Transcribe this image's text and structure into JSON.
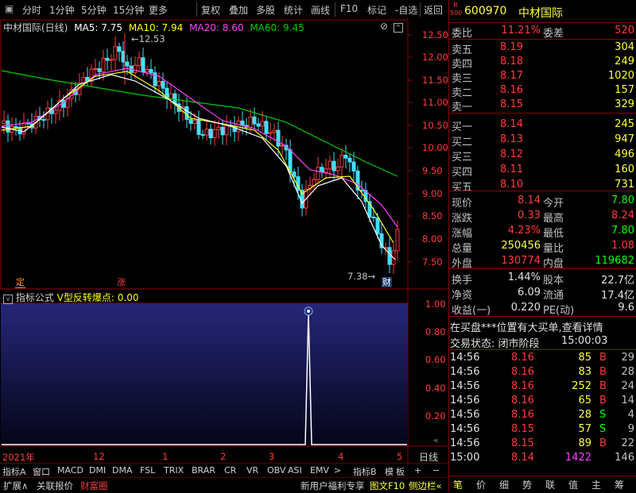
{
  "toolbar": {
    "tabs": [
      "分时",
      "1分钟",
      "5分钟",
      "15分钟",
      "更多",
      "复权",
      "叠加",
      "多股",
      "统计",
      "画线",
      "F10",
      "标记",
      "-自选",
      "返回"
    ]
  },
  "chart": {
    "title": "中材国际(日线)",
    "ma5_label": "MA5: 7.75",
    "ma10_label": "MA10: 7.94",
    "ma20_label": "MA20: 8.60",
    "ma60_label": "MA60: 9.45",
    "high_mark": "12.53",
    "low_mark": "7.38",
    "price_ticks": [
      "12.50",
      "12.00",
      "11.50",
      "11.00",
      "10.50",
      "10.00",
      "9.50",
      "9.00",
      "8.50",
      "8.00",
      "7.50"
    ],
    "markers": {
      "ding": "定",
      "zhang": "涨",
      "cai": "财"
    },
    "colors": {
      "ma5": "#ffffff",
      "ma10": "#ffff00",
      "ma20": "#ff40ff",
      "ma60": "#00cc00",
      "up": "#ff3c3c",
      "down": "#40e0ff"
    }
  },
  "indicator": {
    "label_name": "指标公式",
    "label_formula": "V型反转爆点: 0.00",
    "ticks": [
      "1.00",
      "0.80",
      "0.60",
      "0.40",
      "0.20"
    ],
    "corner_label": "«"
  },
  "xaxis": {
    "labels": [
      "2021年",
      "12",
      "1",
      "2",
      "3",
      "4",
      "5"
    ],
    "period_label": "日线"
  },
  "indicator_tabs": [
    "指标A",
    "窗口",
    "MACD",
    "DMI",
    "DMA",
    "FSL",
    "TRIX",
    "BRAR",
    "CR",
    "VR",
    "OBV",
    "ASI",
    "EMV",
    ">",
    "指标B",
    "模",
    "板",
    "+",
    "−"
  ],
  "bottom_bar": {
    "left": [
      "扩展∧",
      "关联报价",
      "财富圈"
    ],
    "ad": "新用户福利专享",
    "tool1": "图文F10",
    "tool2": "侧边栏«",
    "right": [
      "笔",
      "价",
      "细",
      "势",
      "联",
      "值",
      "主",
      "筹"
    ]
  },
  "quote": {
    "badge_top": "R",
    "badge_bottom": "500",
    "code": "600970",
    "name": "中材国际",
    "weibi_label": "委比",
    "weibi_value": "11.21%",
    "weicha_label": "委差",
    "weicha_value": "520",
    "sells": [
      {
        "label": "卖五",
        "price": "8.19",
        "vol": "304"
      },
      {
        "label": "卖四",
        "price": "8.18",
        "vol": "249"
      },
      {
        "label": "卖三",
        "price": "8.17",
        "vol": "1020"
      },
      {
        "label": "卖二",
        "price": "8.16",
        "vol": "157"
      },
      {
        "label": "卖一",
        "price": "8.15",
        "vol": "329"
      }
    ],
    "buys": [
      {
        "label": "买一",
        "price": "8.14",
        "vol": "245"
      },
      {
        "label": "买二",
        "price": "8.13",
        "vol": "947"
      },
      {
        "label": "买三",
        "price": "8.12",
        "vol": "496"
      },
      {
        "label": "买四",
        "price": "8.11",
        "vol": "160"
      },
      {
        "label": "买五",
        "price": "8.10",
        "vol": "731"
      }
    ],
    "stats": [
      {
        "l1": "现价",
        "v1": "8.14",
        "l2": "今开",
        "v2": "7.80"
      },
      {
        "l1": "涨跌",
        "v1": "0.33",
        "l2": "最高",
        "v2": "8.24"
      },
      {
        "l1": "涨幅",
        "v1": "4.23%",
        "l2": "最低",
        "v2": "7.80"
      },
      {
        "l1": "总量",
        "v1": "250456",
        "l2": "量比",
        "v2": "1.08"
      },
      {
        "l1": "外盘",
        "v1": "130774",
        "l2": "内盘",
        "v2": "119682"
      }
    ],
    "fin": [
      {
        "l1": "换手",
        "v1": "1.44%",
        "l2": "股本",
        "v2": "22.7亿"
      },
      {
        "l1": "净资",
        "v1": "6.09",
        "l2": "流通",
        "v2": "17.4亿"
      },
      {
        "l1": "收益(一)",
        "v1": "0.220",
        "l2": "PE(动)",
        "v2": "9.6"
      }
    ],
    "notice": "在买盘***位置有大买单,查看详情",
    "status_label": "交易状态: 闭市阶段",
    "status_time": "15:00:03",
    "ticks": [
      {
        "t": "14:56",
        "p": "8.16",
        "v": "85",
        "d": "B",
        "n": "29"
      },
      {
        "t": "14:56",
        "p": "8.16",
        "v": "83",
        "d": "B",
        "n": "28"
      },
      {
        "t": "14:56",
        "p": "8.16",
        "v": "252",
        "d": "B",
        "n": "24"
      },
      {
        "t": "14:56",
        "p": "8.16",
        "v": "65",
        "d": "B",
        "n": "14"
      },
      {
        "t": "14:56",
        "p": "8.16",
        "v": "28",
        "d": "S",
        "n": "4"
      },
      {
        "t": "14:56",
        "p": "8.15",
        "v": "57",
        "d": "S",
        "n": "9"
      },
      {
        "t": "14:56",
        "p": "8.15",
        "v": "89",
        "d": "B",
        "n": "22"
      },
      {
        "t": "15:00",
        "p": "8.14",
        "v": "1422",
        "d": "",
        "n": "146"
      }
    ]
  }
}
